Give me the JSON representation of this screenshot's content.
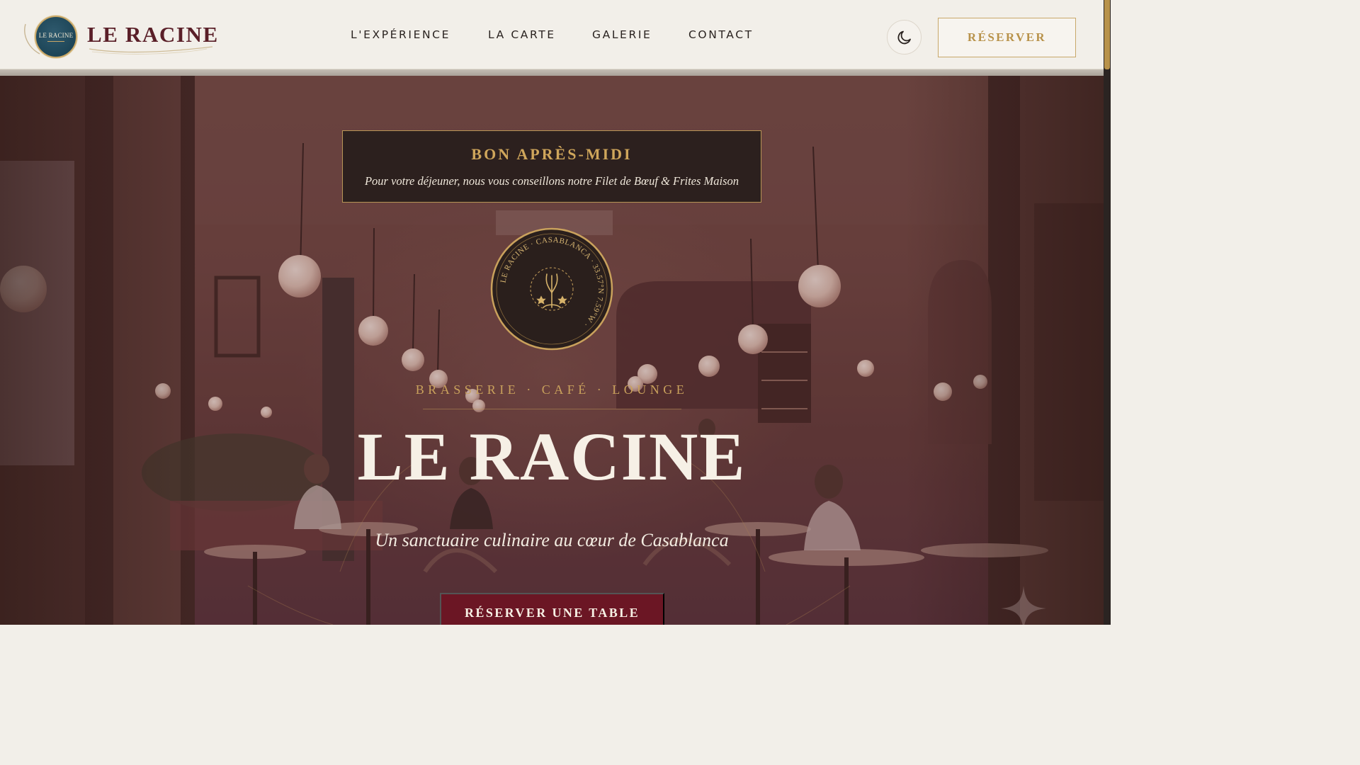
{
  "header": {
    "logo": {
      "badge_text": "LE RACINE",
      "wordmark": "LE RACINE"
    },
    "nav": [
      {
        "label": "L'EXPÉRIENCE"
      },
      {
        "label": "LA CARTE"
      },
      {
        "label": "GALERIE"
      },
      {
        "label": "CONTACT"
      }
    ],
    "theme_toggle_icon": "moon-icon",
    "reserve_label": "RÉSERVER"
  },
  "hero": {
    "suggestion": {
      "title": "BON APRÈS-MIDI",
      "text": "Pour votre déjeuner, nous vous conseillons notre Filet de Bœuf & Frites Maison"
    },
    "seal": {
      "ring_text": "LE RACINE · CASABLANCA · 33.57°N 7.59°W ·",
      "icon": "tree-with-stars-icon"
    },
    "tagline": "BRASSERIE · CAFÉ · LOUNGE",
    "title": "LE RACINE",
    "subtitle": "Un sanctuaire culinaire au cœur de Casablanca",
    "cta_label": "RÉSERVER UNE TABLE"
  },
  "colors": {
    "accent_gold": "#c9a15c",
    "brand_burgundy": "#5a1f28",
    "cta_background": "#6b1624",
    "header_background": "#f2efe9",
    "logo_badge": "#1d4557"
  }
}
